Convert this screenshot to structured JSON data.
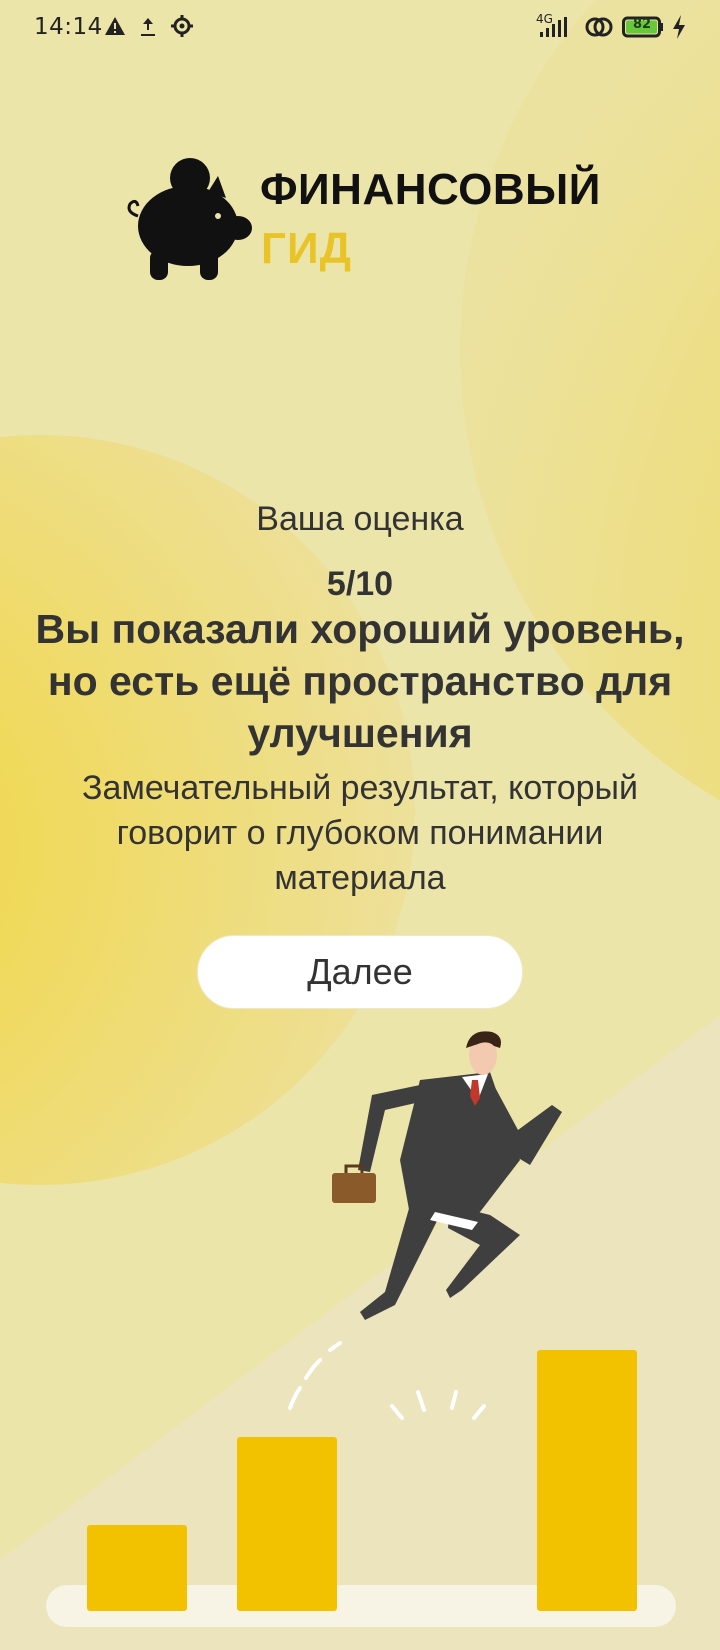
{
  "status_bar": {
    "time": "14:14",
    "network": "4G",
    "battery": "82",
    "icons": [
      "warning-icon",
      "download-icon",
      "gear-icon",
      "signal-icon",
      "link-icon",
      "battery-icon",
      "charging-icon"
    ]
  },
  "logo": {
    "line1": "ФИНАНСОВЫЙ",
    "line2": "ГИД",
    "icon": "piggy-bank-icon"
  },
  "result": {
    "caption": "Ваша оценка",
    "score": "5/10",
    "title": "Вы показали хороший уровень, но есть ещё пространство для улучшения",
    "text": "Замечательный результат, который говорит о глубоком понимании материала"
  },
  "next_button": {
    "label": "Далее"
  },
  "colors": {
    "background": "#ece5aa",
    "accent_yellow": "#f2c200",
    "circle_yellow": "#f0d840",
    "logo_accent": "#e8c428",
    "text": "#333333"
  }
}
